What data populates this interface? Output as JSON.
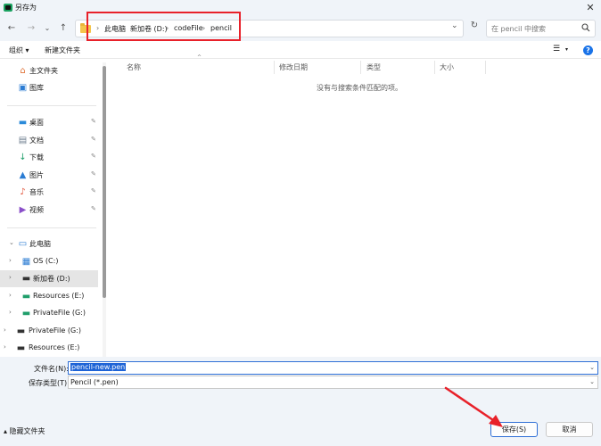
{
  "window": {
    "title": "另存为",
    "close_symbol": "✕"
  },
  "nav": {
    "back": "←",
    "forward": "→",
    "recent": "⌄",
    "up": "↑",
    "breadcrumb": [
      "此电脑",
      "新加卷 (D:)",
      "codeFile",
      "pencil"
    ],
    "separator": "›",
    "dropdown": "⌄",
    "refresh": "↻",
    "search_placeholder": "在 pencil 中搜索"
  },
  "toolbar": {
    "organize_label": "组织 ▾",
    "new_folder_label": "新建文件夹",
    "view_icon": "☰",
    "view_arrow": "▾",
    "help_label": "?"
  },
  "sidebar": {
    "quick": [
      {
        "label": "主文件夹",
        "icon": "home-icon",
        "glyph": "⌂",
        "color": "#e0743a"
      },
      {
        "label": "图库",
        "icon": "gallery-icon",
        "glyph": "▣",
        "color": "#2b7cd3"
      }
    ],
    "pinned": [
      {
        "label": "桌面",
        "icon": "desktop-icon",
        "glyph": "▬",
        "color": "#2b8ad9"
      },
      {
        "label": "文档",
        "icon": "documents-icon",
        "glyph": "▤",
        "color": "#6b7b8c"
      },
      {
        "label": "下载",
        "icon": "downloads-icon",
        "glyph": "↓",
        "color": "#1f9e6a"
      },
      {
        "label": "图片",
        "icon": "pictures-icon",
        "glyph": "▲",
        "color": "#2b7cd3"
      },
      {
        "label": "音乐",
        "icon": "music-icon",
        "glyph": "♪",
        "color": "#e2553b"
      },
      {
        "label": "视频",
        "icon": "videos-icon",
        "glyph": "▶",
        "color": "#8a4fc9"
      }
    ],
    "pin_glyph": "📌",
    "this_pc": {
      "label": "此电脑",
      "icon": "computer-icon"
    },
    "drives": [
      {
        "label": "OS (C:)",
        "icon": "windows-drive-icon"
      },
      {
        "label": "新加卷 (D:)",
        "icon": "drive-icon",
        "selected": true
      },
      {
        "label": "Resources (E:)",
        "icon": "drive-icon"
      },
      {
        "label": "PrivateFile (G:)",
        "icon": "drive-icon"
      }
    ],
    "network": [
      {
        "label": "PrivateFile (G:)",
        "icon": "drive-icon"
      },
      {
        "label": "Resources (E:)",
        "icon": "drive-icon"
      }
    ]
  },
  "list": {
    "columns": [
      "名称",
      "修改日期",
      "类型",
      "大小"
    ],
    "sort_indicator": "^",
    "empty_message": "没有与搜索条件匹配的项。"
  },
  "form": {
    "filename_label": "文件名(N):",
    "filename_value": "pencil-new.pen",
    "filetype_label": "保存类型(T):",
    "filetype_value": "Pencil (*.pen)",
    "dropdown_arrow": "⌄"
  },
  "footer": {
    "hide_folders_label": "▴ 隐藏文件夹",
    "save_label": "保存(S)",
    "cancel_label": "取消"
  },
  "colors": {
    "annotation": "#e8212a",
    "accent": "#2f6fd6"
  }
}
